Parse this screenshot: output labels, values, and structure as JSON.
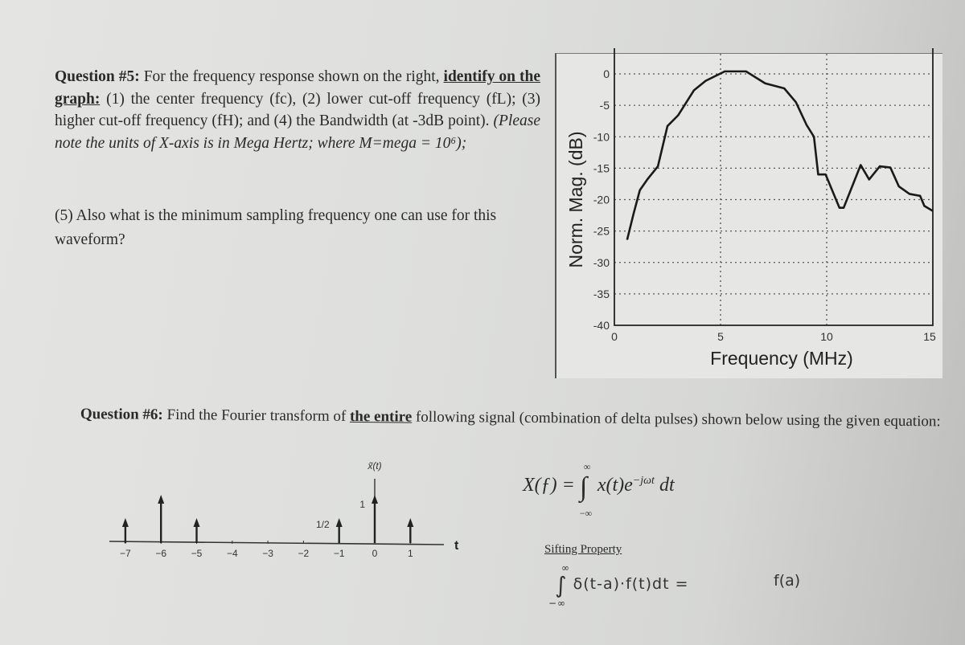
{
  "question5": {
    "label": "Question #5:",
    "intro": " For the frequency response shown on the right,",
    "underline": "identify on the graph:",
    "body": " (1) the center frequency (fc), (2) lower cut-off frequency (fL); (3) higher cut-off frequency (fH); and (4) the Bandwidth (at -3dB point). ",
    "italic_note": "(Please note the units of X-axis is in Mega Hertz; where M=mega = 10⁶);",
    "part5": "(5) Also what is the minimum sampling frequency one can use for this waveform?"
  },
  "question6": {
    "label": "Question #6:",
    "text_before": " Find the Fourier transform of ",
    "underline": "the entire",
    "text_after": " following signal (combination of delta pulses) shown below using the given equation:"
  },
  "equations": {
    "fourier": "X(f) = ∫ x(t)e^(−jωt) dt",
    "fourier_lhs": "X(ƒ) =",
    "fourier_integrand": "x(t)e",
    "fourier_exp": "−jωt",
    "fourier_dt": "dt",
    "upper_limit": "∞",
    "lower_limit": "−∞",
    "sifting_title": "Sifting Property",
    "sifting_lhs": "δ(t-a)·f(t)dt  =",
    "sifting_rhs": "f(a)"
  },
  "chart_data": [
    {
      "type": "line",
      "title": "",
      "xlabel": "Frequency (MHz)",
      "ylabel": "Norm. Mag. (dB)",
      "xlim": [
        0,
        15
      ],
      "ylim": [
        -40,
        0
      ],
      "xticks": [
        0,
        5,
        10,
        15
      ],
      "yticks": [
        0,
        -5,
        -10,
        -15,
        -20,
        -25,
        -30,
        -35,
        -40
      ],
      "grid": true,
      "line_color": "#1a1a1a",
      "x": [
        0.6,
        0.9,
        1.2,
        1.55,
        2.05,
        2.5,
        3.0,
        3.75,
        4.3,
        5.2,
        6.2,
        7.1,
        8.0,
        8.55,
        9.05,
        9.4,
        9.6,
        9.95,
        10.6,
        10.8,
        11.6,
        12.0,
        12.5,
        13.0,
        13.4,
        13.9,
        14.4,
        14.6,
        15.0
      ],
      "y": [
        -26.4,
        -22.3,
        -18.5,
        -16.8,
        -14.7,
        -8.3,
        -6.6,
        -2.6,
        -1.1,
        0.4,
        0.4,
        -1.5,
        -2.3,
        -4.5,
        -8.1,
        -10,
        -16,
        -16,
        -21.3,
        -21.3,
        -14.5,
        -16.8,
        -14.7,
        -14.9,
        -17.9,
        -19.1,
        -19.4,
        -21,
        -21.8
      ]
    },
    {
      "type": "stem",
      "title": "x̃(t)",
      "xlabel": "t",
      "xticks": [
        "−7",
        "−6",
        "−5",
        "−4",
        "−3",
        "−2",
        "−1",
        "0",
        "1"
      ],
      "impulses": [
        {
          "t": -7,
          "value": 0.5
        },
        {
          "t": -6,
          "value": 1
        },
        {
          "t": -5,
          "value": 0.5
        },
        {
          "t": -1,
          "value": 0.5,
          "label": "1/2"
        },
        {
          "t": 0,
          "value": 1,
          "label": "1"
        },
        {
          "t": 1,
          "value": 0.5
        }
      ]
    }
  ]
}
